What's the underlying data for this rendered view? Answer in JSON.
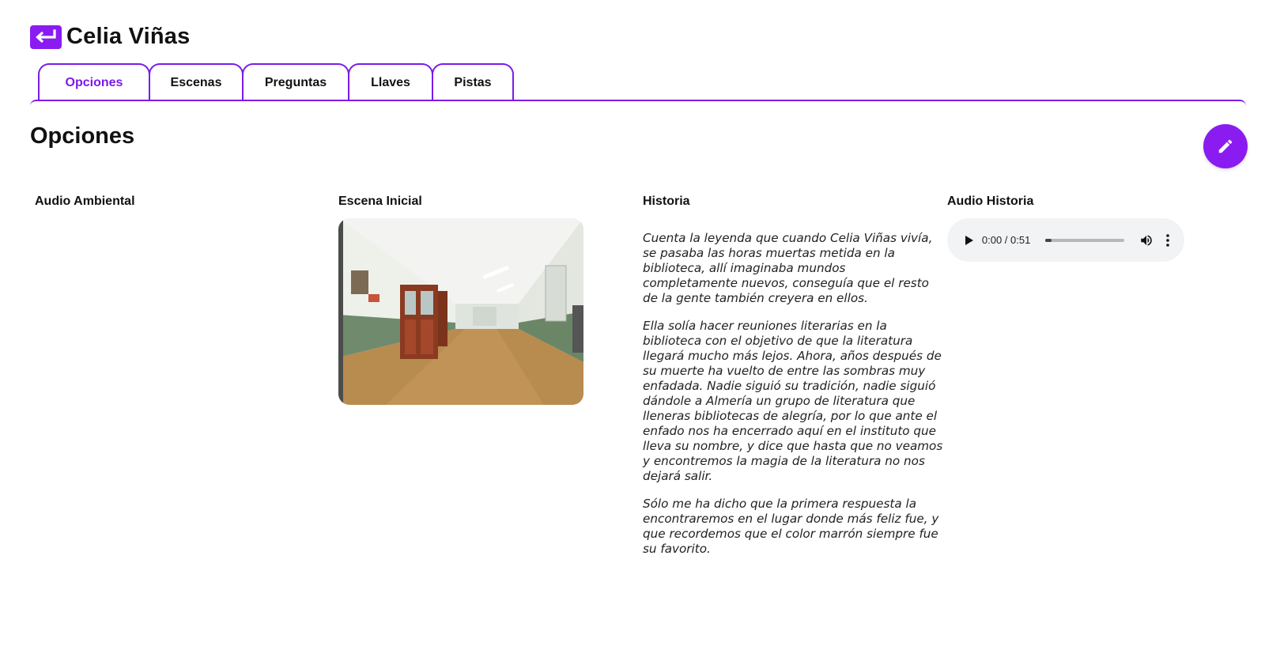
{
  "header": {
    "title": "Celia Viñas"
  },
  "tabs": [
    {
      "label": "Opciones",
      "active": true
    },
    {
      "label": "Escenas"
    },
    {
      "label": "Preguntas"
    },
    {
      "label": "Llaves"
    },
    {
      "label": "Pistas"
    }
  ],
  "section": {
    "title": "Opciones"
  },
  "columns": {
    "audio_ambiental": {
      "label": "Audio Ambiental"
    },
    "escena_inicial": {
      "label": "Escena Inicial"
    },
    "historia": {
      "label": "Historia",
      "paragraphs": [
        "Cuenta la leyenda que cuando Celia Viñas vivía, se pasaba las horas muertas metida en la biblioteca, allí imaginaba mundos completamente nuevos, conseguía que el resto de la gente también creyera en ellos.",
        " Ella solía hacer reuniones literarias en la biblioteca con el objetivo de que la literatura llegará mucho más lejos. Ahora, años después de su muerte ha vuelto de entre las sombras muy enfadada. Nadie siguió su tradición, nadie siguió dándole a Almería un grupo de literatura que lleneras bibliotecas de alegría, por lo que ante el enfado nos ha encerrado aquí en el instituto que lleva su nombre, y dice que hasta que no veamos y encontremos la magia de la literatura no nos dejará salir.",
        "Sólo me ha dicho que la primera respuesta la encontraremos en el lugar donde más feliz fue, y que recordemos que el color marrón siempre fue su favorito."
      ]
    },
    "audio_historia": {
      "label": "Audio Historia",
      "time": "0:00 / 0:51",
      "progress": 0
    }
  },
  "colors": {
    "accent": "#8a1cf2",
    "tab_border": "#7a1be8",
    "audio_bg": "#f1f3f4"
  },
  "icons": {
    "back": "arrow-left-return-icon",
    "edit": "pencil-icon",
    "play": "play-icon",
    "volume": "volume-icon",
    "more": "more-vertical-icon"
  }
}
